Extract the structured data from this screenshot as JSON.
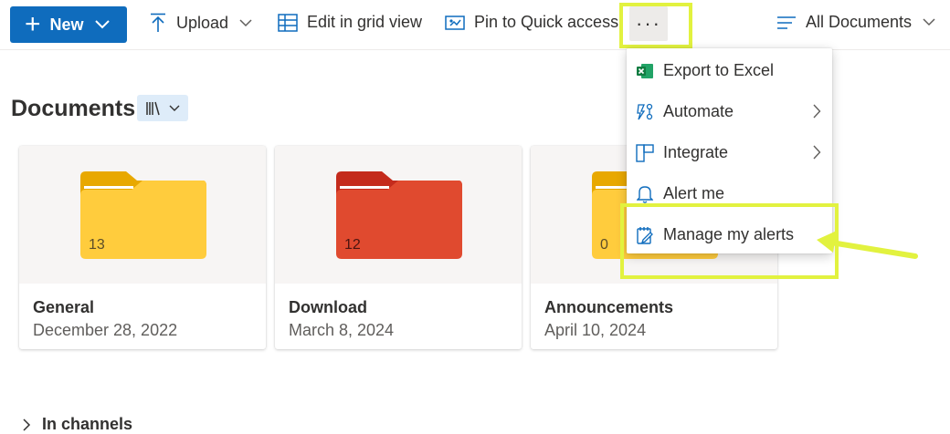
{
  "toolbar": {
    "new_label": "New",
    "upload_label": "Upload",
    "grid_label": "Edit in grid view",
    "pin_label": "Pin to Quick access",
    "more_label": "···",
    "view_label": "All Documents"
  },
  "page": {
    "title": "Documents"
  },
  "folders": [
    {
      "name": "General",
      "date": "December 28, 2022",
      "count": "13",
      "color": "#ffc83d"
    },
    {
      "name": "Download",
      "date": "March 8, 2024",
      "count": "12",
      "color": "#e53b2b"
    },
    {
      "name": "Announcements",
      "date": "April 10, 2024",
      "count": "0",
      "color": "#ffc83d"
    }
  ],
  "section": {
    "in_channels": "In channels"
  },
  "menu": {
    "items": [
      {
        "label": "Export to Excel",
        "icon": "excel-icon"
      },
      {
        "label": "Automate",
        "icon": "automate-icon",
        "submenu": true
      },
      {
        "label": "Integrate",
        "icon": "integrate-icon",
        "submenu": true
      },
      {
        "label": "Alert me",
        "icon": "bell-icon"
      },
      {
        "label": "Manage my alerts",
        "icon": "manage-alerts-icon"
      }
    ]
  },
  "colors": {
    "accent": "#0f6cbd",
    "highlight": "#e2f23f"
  }
}
